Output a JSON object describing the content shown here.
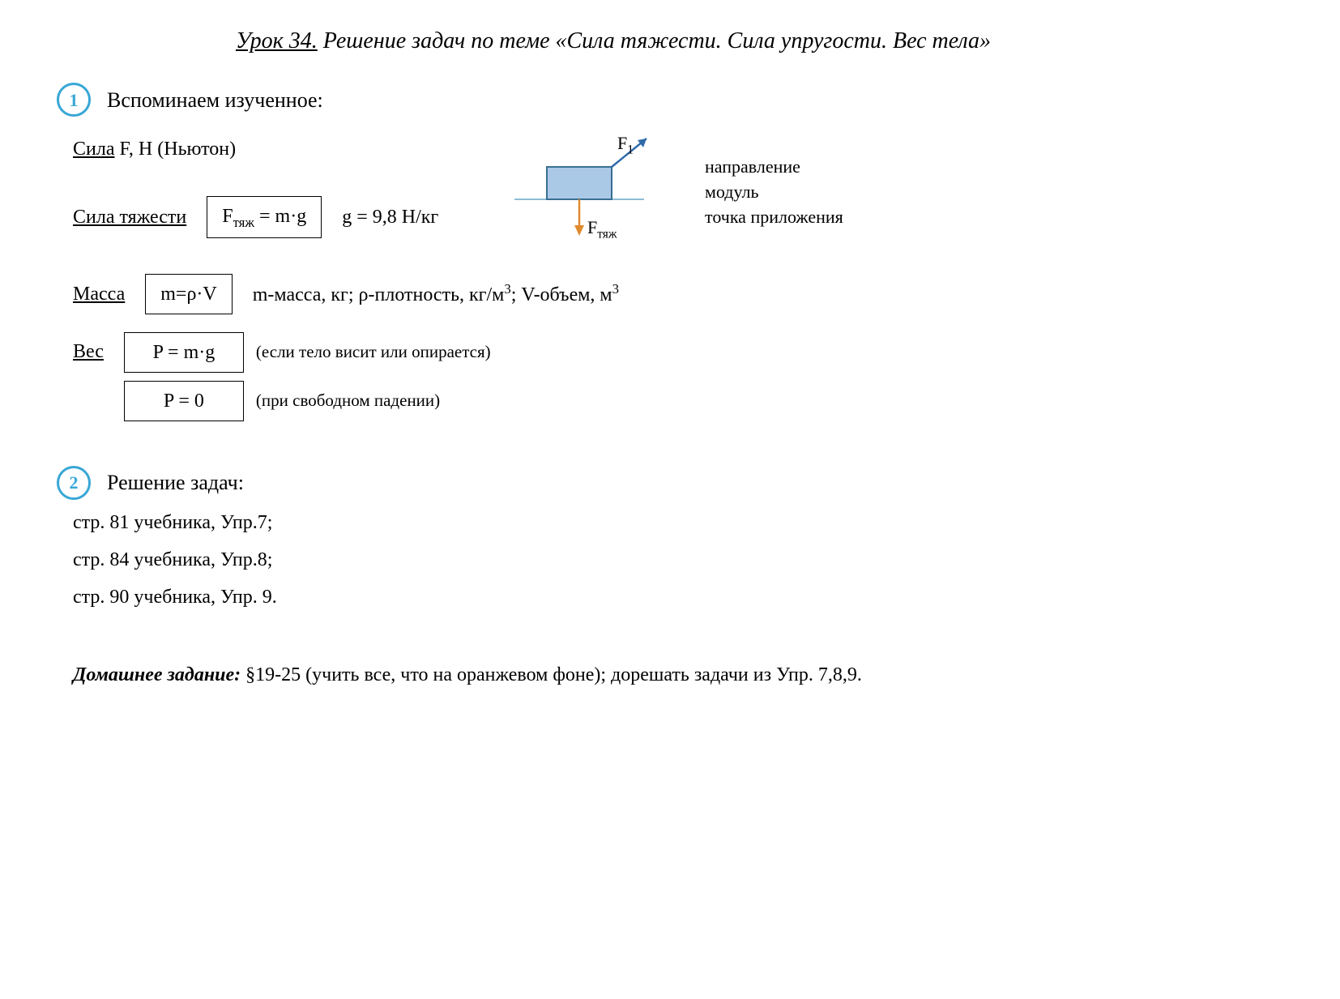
{
  "title": {
    "lesson_label": "Урок 34.",
    "rest": " Решение задач по теме «Сила тяжести. Сила упругости. Вес тела»"
  },
  "section1": {
    "number": "1",
    "heading": "Вспоминаем изученное:",
    "force": {
      "label": "Сила",
      "desc": " F, Н (Ньютон)"
    },
    "gravity": {
      "label": "Сила тяжести",
      "formula_prefix": "F",
      "formula_sub": "тяж",
      "formula_rest": " = m·g",
      "g_value": "g = 9,8 Н/кг"
    },
    "mass": {
      "label": "Масса",
      "formula": "m=ρ·V",
      "desc_plain1": "m-масса, кг; ρ-плотность, кг/м",
      "desc_sup1": "3",
      "desc_plain2": "; V-объем, м",
      "desc_sup2": "3"
    },
    "weight": {
      "label": "Вес",
      "formula1": "P = m·g",
      "note1": "(если тело висит или опирается)",
      "formula2": "P = 0",
      "note2": "(при свободном падении)"
    },
    "diagram": {
      "f1_prefix": "F",
      "f1_sub": "1",
      "ftag_prefix": "F",
      "ftag_sub": "тяж"
    },
    "force_notes": {
      "n1": "направление",
      "n2": "модуль",
      "n3": "точка приложения"
    }
  },
  "section2": {
    "number": "2",
    "heading": "Решение задач:",
    "tasks": [
      "стр. 81 учебника, Упр.7;",
      "стр. 84 учебника, Упр.8;",
      "стр. 90 учебника, Упр. 9."
    ]
  },
  "homework": {
    "label": "Домашнее задание:",
    "text": " §19-25 (учить все, что на оранжевом фоне); дорешать задачи из Упр. 7,8,9."
  }
}
